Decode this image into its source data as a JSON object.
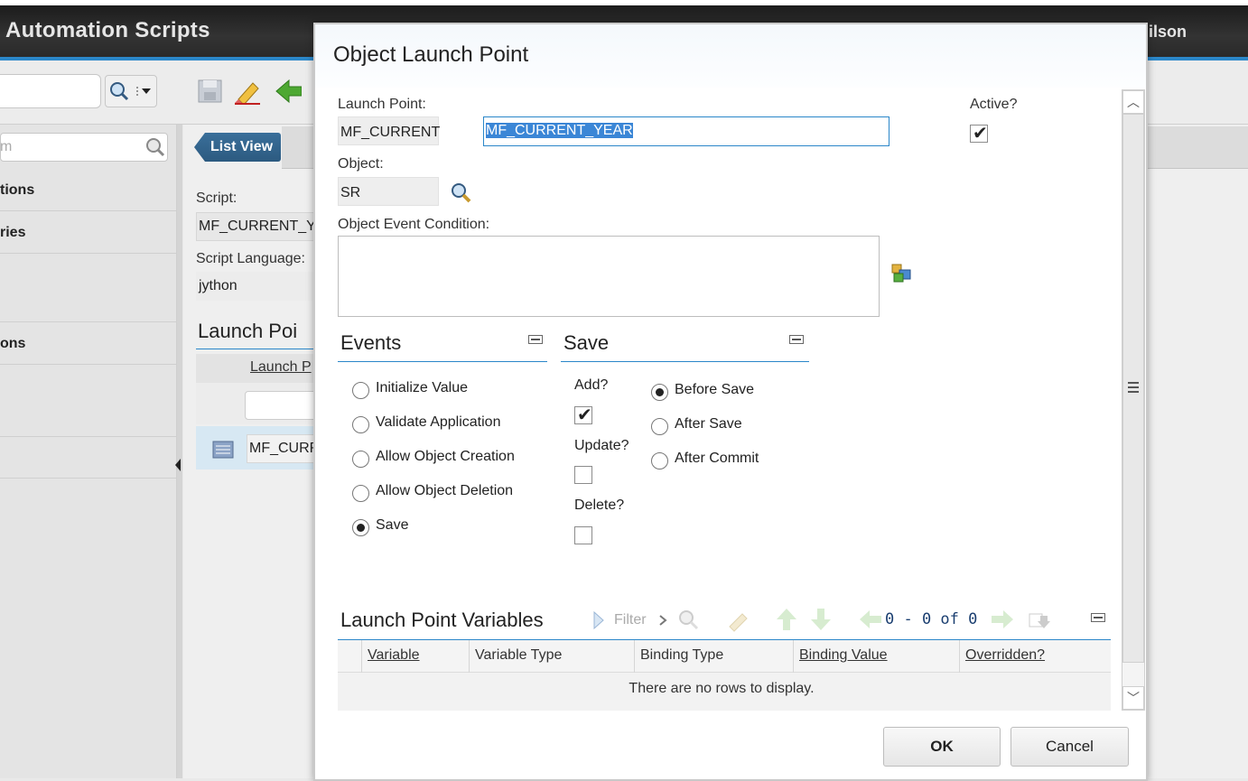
{
  "app": {
    "title": "Automation Scripts",
    "user": "ilson"
  },
  "side": {
    "search_placeholder": "m",
    "items": [
      "tions",
      "ries",
      "ons"
    ]
  },
  "list_view": "List View",
  "bg": {
    "script_label": "Script:",
    "script_value": "MF_CURRENT_Y",
    "lang_label": "Script Language:",
    "lang_value": "jython",
    "lp_title": "Launch Poi",
    "lp_col": "Launch P",
    "lp_row": "MF_CURR"
  },
  "dialog": {
    "title": "Object Launch Point",
    "launch_point_label": "Launch Point:",
    "launch_point_short": "MF_CURRENT",
    "launch_point_value": "MF_CURRENT_YEAR",
    "active_label": "Active?",
    "active_checked": true,
    "object_label": "Object:",
    "object_value": "SR",
    "condition_label": "Object Event Condition:",
    "condition_value": "",
    "events": {
      "title": "Events",
      "options": [
        {
          "label": "Initialize Value",
          "selected": false
        },
        {
          "label": "Validate Application",
          "selected": false
        },
        {
          "label": "Allow Object Creation",
          "selected": false
        },
        {
          "label": "Allow Object Deletion",
          "selected": false
        },
        {
          "label": "Save",
          "selected": true
        }
      ]
    },
    "save": {
      "title": "Save",
      "add_label": "Add?",
      "add_checked": true,
      "update_label": "Update?",
      "update_checked": false,
      "delete_label": "Delete?",
      "delete_checked": false,
      "options": [
        {
          "label": "Before Save",
          "selected": true
        },
        {
          "label": "After Save",
          "selected": false
        },
        {
          "label": "After Commit",
          "selected": false
        }
      ]
    },
    "variables": {
      "title": "Launch Point Variables",
      "filter_label": "Filter",
      "pager": "0 - 0 of 0",
      "columns": [
        "Variable",
        "Variable Type",
        "Binding Type",
        "Binding Value",
        "Overridden?"
      ],
      "empty_text": "There are no rows to display."
    },
    "ok_label": "OK",
    "cancel_label": "Cancel"
  }
}
